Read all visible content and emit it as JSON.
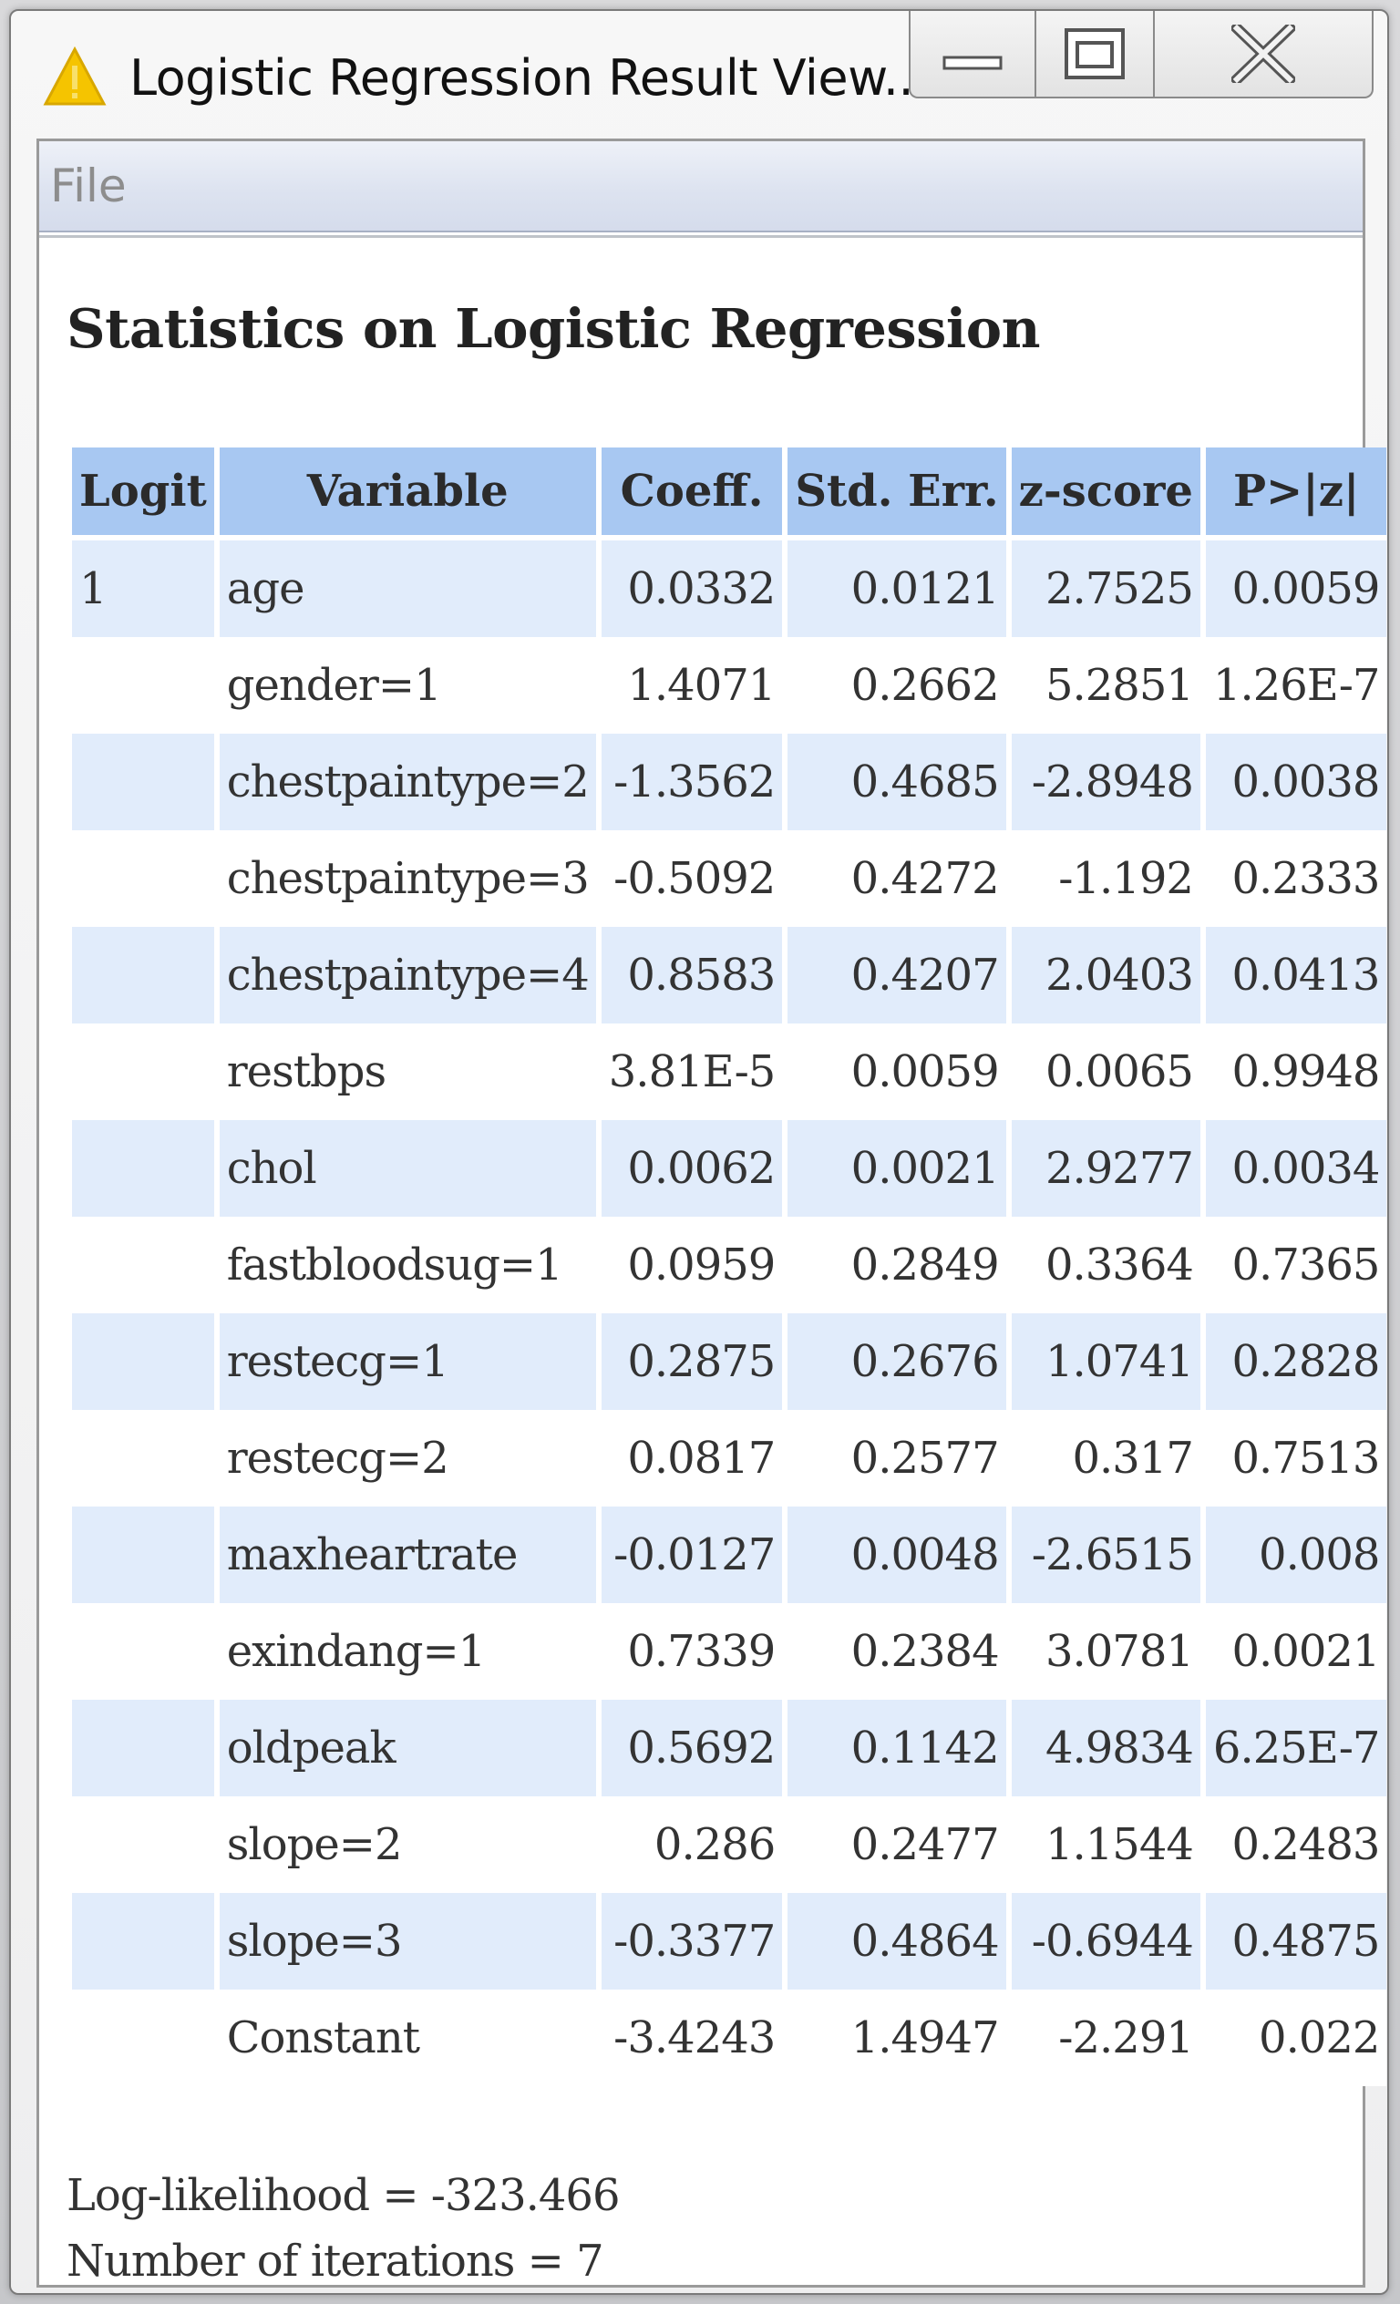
{
  "window": {
    "title": "Logistic Regression Result View...",
    "icon": "warning-icon",
    "buttons": {
      "minimize": "minimize-icon",
      "maximize": "maximize-icon",
      "close": "close-icon"
    }
  },
  "menu": {
    "items": [
      "File"
    ]
  },
  "report": {
    "heading": "Statistics on Logistic Regression",
    "columns": [
      "Logit",
      "Variable",
      "Coeff.",
      "Std. Err.",
      "z-score",
      "P>|z|"
    ],
    "rows": [
      {
        "logit": "1",
        "variable": "age",
        "coeff": "0.0332",
        "std_err": "0.0121",
        "z": "2.7525",
        "p": "0.0059"
      },
      {
        "logit": "",
        "variable": "gender=1",
        "coeff": "1.4071",
        "std_err": "0.2662",
        "z": "5.2851",
        "p": "1.26E-7"
      },
      {
        "logit": "",
        "variable": "chestpaintype=2",
        "coeff": "-1.3562",
        "std_err": "0.4685",
        "z": "-2.8948",
        "p": "0.0038"
      },
      {
        "logit": "",
        "variable": "chestpaintype=3",
        "coeff": "-0.5092",
        "std_err": "0.4272",
        "z": "-1.192",
        "p": "0.2333"
      },
      {
        "logit": "",
        "variable": "chestpaintype=4",
        "coeff": "0.8583",
        "std_err": "0.4207",
        "z": "2.0403",
        "p": "0.0413"
      },
      {
        "logit": "",
        "variable": "restbps",
        "coeff": "3.81E-5",
        "std_err": "0.0059",
        "z": "0.0065",
        "p": "0.9948"
      },
      {
        "logit": "",
        "variable": "chol",
        "coeff": "0.0062",
        "std_err": "0.0021",
        "z": "2.9277",
        "p": "0.0034"
      },
      {
        "logit": "",
        "variable": "fastbloodsug=1",
        "coeff": "0.0959",
        "std_err": "0.2849",
        "z": "0.3364",
        "p": "0.7365"
      },
      {
        "logit": "",
        "variable": "restecg=1",
        "coeff": "0.2875",
        "std_err": "0.2676",
        "z": "1.0741",
        "p": "0.2828"
      },
      {
        "logit": "",
        "variable": "restecg=2",
        "coeff": "0.0817",
        "std_err": "0.2577",
        "z": "0.317",
        "p": "0.7513"
      },
      {
        "logit": "",
        "variable": "maxheartrate",
        "coeff": "-0.0127",
        "std_err": "0.0048",
        "z": "-2.6515",
        "p": "0.008"
      },
      {
        "logit": "",
        "variable": "exindang=1",
        "coeff": "0.7339",
        "std_err": "0.2384",
        "z": "3.0781",
        "p": "0.0021"
      },
      {
        "logit": "",
        "variable": "oldpeak",
        "coeff": "0.5692",
        "std_err": "0.1142",
        "z": "4.9834",
        "p": "6.25E-7"
      },
      {
        "logit": "",
        "variable": "slope=2",
        "coeff": "0.286",
        "std_err": "0.2477",
        "z": "1.1544",
        "p": "0.2483"
      },
      {
        "logit": "",
        "variable": "slope=3",
        "coeff": "-0.3377",
        "std_err": "0.4864",
        "z": "-0.6944",
        "p": "0.4875"
      },
      {
        "logit": "",
        "variable": "Constant",
        "coeff": "-3.4243",
        "std_err": "1.4947",
        "z": "-2.291",
        "p": "0.022"
      }
    ],
    "log_likelihood": "Log-likelihood = -323.466",
    "iterations": "Number of iterations = 7"
  },
  "colors": {
    "header_bg": "#a8c8f2",
    "odd_row_bg": "#e1ecfb",
    "even_row_bg": "#ffffff",
    "warning_icon": "#f5c400"
  }
}
